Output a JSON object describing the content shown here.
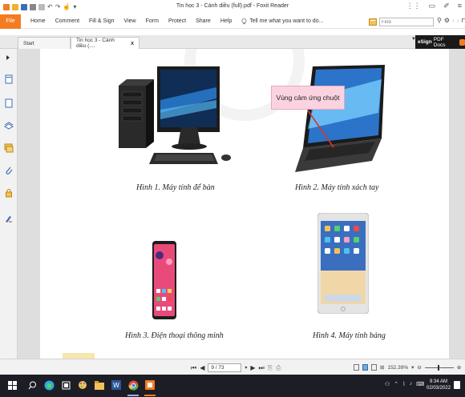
{
  "window": {
    "title": "Tin học 3 - Cánh diều (full).pdf - Foxit Reader"
  },
  "menu": {
    "file": "File",
    "items": [
      "Home",
      "Comment",
      "Fill & Sign",
      "View",
      "Form",
      "Protect",
      "Share",
      "Help"
    ],
    "tell_me": "Tell me what you want to do..."
  },
  "search": {
    "placeholder": "Find"
  },
  "tabs": [
    {
      "label": "Start",
      "active": false
    },
    {
      "label": "Tin học 3 - Cánh diều (....",
      "active": true,
      "close": "x"
    }
  ],
  "esign": {
    "brand": "eSign",
    "label": "PDF Docs"
  },
  "document": {
    "callout": "Vùng cảm ứng chuột",
    "captions": [
      "Hình 1. Máy tính để bàn",
      "Hình 2. Máy tính xách tay",
      "Hình 3. Điện thoại thông minh",
      "Hình 4. Máy tính bảng"
    ]
  },
  "navigation": {
    "page": "9 / 73",
    "zoom": "152.39%"
  },
  "taskbar": {
    "time": "9:34 AM",
    "date": "02/03/2022"
  },
  "colors": {
    "foxit_orange": "#f47c20",
    "taskbar": "#1d1d26",
    "callout_fill": "#fbd3e0",
    "callout_pointer": "#d9362b"
  }
}
